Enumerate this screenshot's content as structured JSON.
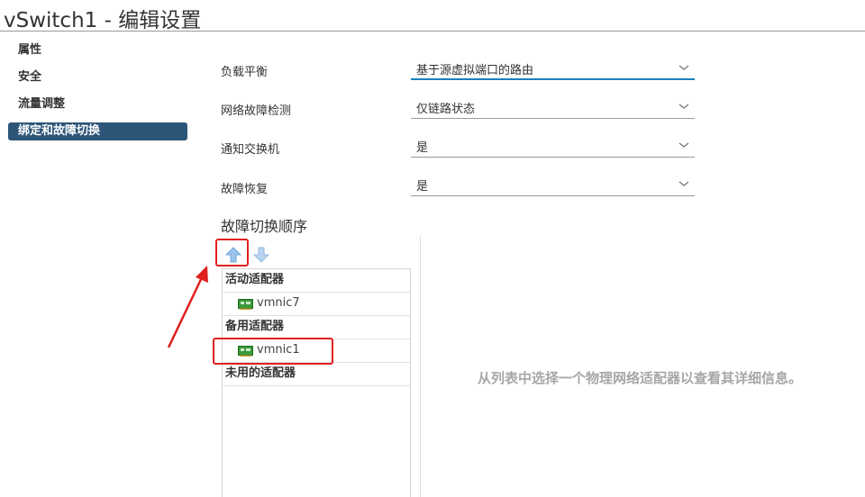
{
  "window": {
    "title": "vSwitch1 - 编辑设置"
  },
  "sidebar": {
    "items": [
      {
        "label": "属性",
        "active": false
      },
      {
        "label": "安全",
        "active": false
      },
      {
        "label": "流量调整",
        "active": false
      },
      {
        "label": "绑定和故障切换",
        "active": true
      }
    ]
  },
  "form": {
    "fields": [
      {
        "label": "负载平衡",
        "value": "基于源虚拟端口的路由"
      },
      {
        "label": "网络故障检测",
        "value": "仅链路状态"
      },
      {
        "label": "通知交换机",
        "value": "是"
      },
      {
        "label": "故障恢复",
        "value": "是"
      }
    ]
  },
  "failover": {
    "title": "故障切换顺序",
    "toolbar": {
      "move_up_icon": "arrow-up-icon",
      "move_down_icon": "arrow-down-icon"
    },
    "groups": [
      {
        "header": "活动适配器",
        "items": [
          "vmnic7"
        ]
      },
      {
        "header": "备用适配器",
        "items": [
          "vmnic1"
        ]
      },
      {
        "header": "未用的适配器",
        "items": []
      }
    ],
    "details_placeholder": "从列表中选择一个物理网络适配器以查看其详细信息。"
  },
  "colors": {
    "accent": "#1a7fc1",
    "active_nav": "#2d5578",
    "annotation": "#e02020",
    "nic_green": "#3a9a3a"
  }
}
